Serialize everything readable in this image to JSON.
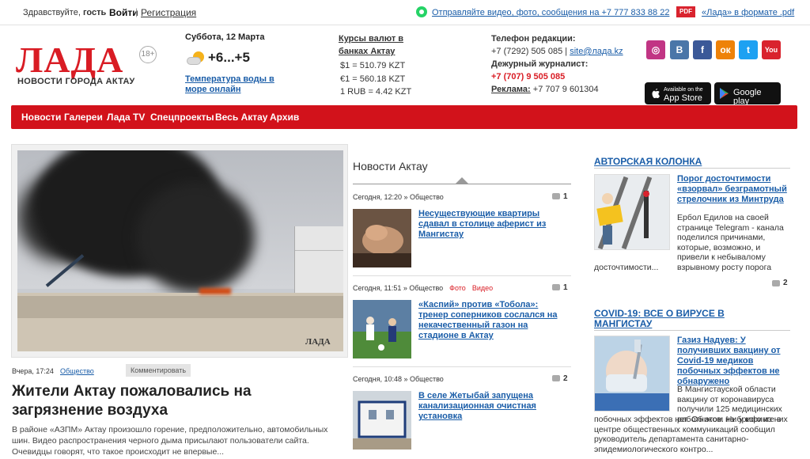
{
  "topbar": {
    "greeting_prefix": "Здравствуйте,",
    "greeting_user": "гость",
    "login": "Войти",
    "separator": "|",
    "register": "Регистрация",
    "whatsapp_text": "Отправляйте видео, фото, сообщения на +7 777 833 88 22",
    "pdf_badge": "PDF",
    "pdf_text": "«Лада» в формате .pdf"
  },
  "header": {
    "logo": "ЛАДА",
    "age_rating": "18+",
    "tagline": "НОВОСТИ ГОРОДА АКТАУ",
    "date": "Суббота, 12 Марта",
    "temperature": "+6...+5",
    "water_temp_link": "Температура воды в море онлайн",
    "rates_title": "Курсы валют в банках Актау",
    "rates": [
      "$1 = 510.79 KZT",
      "€1 = 560.18 KZT",
      "1 RUB = 4.42 KZT"
    ],
    "phone_label": "Телефон редакции:",
    "phone": "+7 (7292) 505 085",
    "phone_sep": "|",
    "site": "site@лада.kz",
    "journalist_label": "Дежурный журналист:",
    "journalist_phone": "+7 (707) 9 505 085",
    "ads_label": "Реклама:",
    "ads_phone": "+7 707 9 601304",
    "socials": [
      {
        "name": "instagram",
        "glyph": "◎",
        "color": "#c13584"
      },
      {
        "name": "vk",
        "glyph": "В",
        "color": "#4a76a8"
      },
      {
        "name": "facebook",
        "glyph": "f",
        "color": "#3b5998"
      },
      {
        "name": "odnoklassniki",
        "glyph": "ок",
        "color": "#ee8208"
      },
      {
        "name": "twitter",
        "glyph": "t",
        "color": "#1da1f2"
      },
      {
        "name": "youtube",
        "glyph": "You",
        "color": "#d9232e"
      }
    ],
    "app_store_small": "Available on the",
    "app_store": "App Store",
    "google_play": "Google play"
  },
  "nav": {
    "items": [
      "Новости",
      "Галереи",
      "Лада TV",
      "Спецпроекты",
      "Весь Актау",
      "Архив"
    ]
  },
  "lead": {
    "watermark": "ЛАДА",
    "time": "Вчера, 17:24",
    "category": "Общество",
    "comment_button": "Комментировать",
    "title": "Жители Актау пожаловались на загрязнение воздуха",
    "text": "В районе «АЗПМ» Актау произошло горение, предположительно, автомобильных шин. Видео распространения черного дыма присылают пользователи сайта. Очевидцы говорят, что такое происходит не впервые..."
  },
  "middle": {
    "section_title": "Новости Актау",
    "items": [
      {
        "meta": "Сегодня, 12:20 » Общество",
        "photo": "",
        "video": "",
        "comments": "1",
        "title": "Несуществующие квартиры сдавал в столице аферист из Мангистау"
      },
      {
        "meta": "Сегодня, 11:51 » Общество",
        "photo": "Фото",
        "video": "Видео",
        "comments": "1",
        "title": "«Каспий» против «Тобола»: тренер соперников сослался на некачественный газон на стадионе в Актау"
      },
      {
        "meta": "Сегодня, 10:48 » Общество",
        "photo": "",
        "video": "",
        "comments": "2",
        "title": "В селе Жетыбай запущена канализационная очистная установка"
      }
    ]
  },
  "right": {
    "column_title": "АВТОРСКАЯ КОЛОНКА",
    "column_item_title": "Порог досточтимости «взорвал» безграмотный стрелочник из Минтруда",
    "column_item_text_short": "Ербол Едилов на своей странице Telegram - канала поделился причинами, которые, возможно, и привели к небывалому взрывному росту порога",
    "column_item_text_wide": "досточтимости...",
    "column_comments": "2",
    "covid_title": "COVID-19: ВСЕ О ВИРУСЕ В МАНГИСТАУ",
    "covid_item_title": "Газиз Надуев: У получивших вакцину от Covid-19 медиков побочных эффектов не обнаружено",
    "covid_item_text_short": "В Мангистауской области вакцину от коронавируса получили 125 медицинских работников. Ни у кого из них",
    "covid_item_text_wide": "побочных эффектов нет. Об этом на брифинге в центре общественных коммуникаций сообщил руководитель департамента санитарно-эпидемиологического контро..."
  }
}
